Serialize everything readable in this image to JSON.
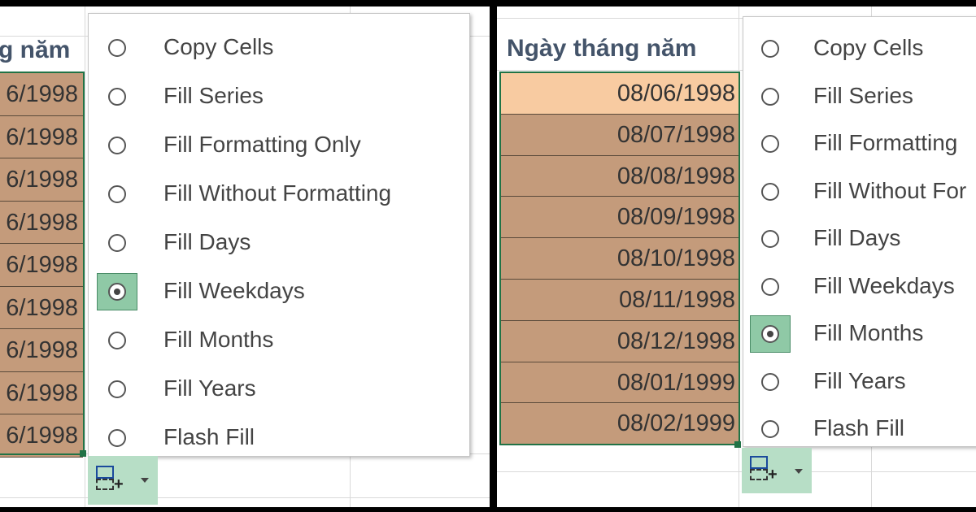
{
  "left": {
    "header": "g năm",
    "dates": [
      "6/1998",
      "6/1998",
      "6/1998",
      "6/1998",
      "6/1998",
      "6/1998",
      "6/1998",
      "6/1998",
      "6/1998"
    ],
    "menu_items": [
      {
        "label": "Copy Cells",
        "selected": false
      },
      {
        "label": "Fill Series",
        "selected": false
      },
      {
        "label": "Fill Formatting Only",
        "selected": false
      },
      {
        "label": "Fill Without Formatting",
        "selected": false
      },
      {
        "label": "Fill Days",
        "selected": false
      },
      {
        "label": "Fill Weekdays",
        "selected": true
      },
      {
        "label": "Fill Months",
        "selected": false
      },
      {
        "label": "Fill Years",
        "selected": false
      },
      {
        "label": "Flash Fill",
        "selected": false
      }
    ]
  },
  "right": {
    "header": "Ngày tháng năm",
    "dates": [
      "08/06/1998",
      "08/07/1998",
      "08/08/1998",
      "08/09/1998",
      "08/10/1998",
      "08/11/1998",
      "08/12/1998",
      "08/01/1999",
      "08/02/1999"
    ],
    "menu_items": [
      {
        "label": "Copy Cells",
        "selected": false
      },
      {
        "label": "Fill Series",
        "selected": false
      },
      {
        "label": "Fill Formatting",
        "selected": false
      },
      {
        "label": "Fill Without For",
        "selected": false
      },
      {
        "label": "Fill Days",
        "selected": false
      },
      {
        "label": "Fill Weekdays",
        "selected": false
      },
      {
        "label": "Fill Months",
        "selected": true
      },
      {
        "label": "Fill Years",
        "selected": false
      },
      {
        "label": "Flash Fill",
        "selected": false
      }
    ]
  },
  "colors": {
    "selection": "#217346",
    "cell_tan": "#c49b7b",
    "cell_peach": "#f8cba1",
    "header_text": "#44546a"
  },
  "icons": {
    "autofill": "auto-fill-options-icon",
    "dropdown": "caret-down-icon"
  }
}
